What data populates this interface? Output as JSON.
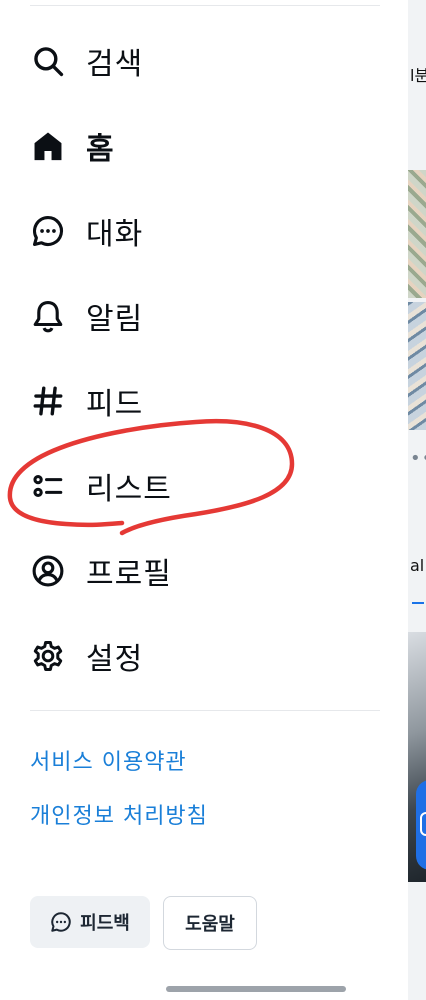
{
  "nav": {
    "items": [
      {
        "label": "검색",
        "icon": "search-icon"
      },
      {
        "label": "홈",
        "icon": "home-icon"
      },
      {
        "label": "대화",
        "icon": "chat-bubble-icon"
      },
      {
        "label": "알림",
        "icon": "bell-icon"
      },
      {
        "label": "피드",
        "icon": "hashtag-icon"
      },
      {
        "label": "리스트",
        "icon": "list-icon"
      },
      {
        "label": "프로필",
        "icon": "user-circle-icon"
      },
      {
        "label": "설정",
        "icon": "gear-icon"
      }
    ]
  },
  "links": {
    "terms": "서비스 이용약관",
    "privacy": "개인정보 처리방침"
  },
  "buttons": {
    "feedback": "피드백",
    "help": "도움말"
  },
  "background": {
    "snippet_1": "l분",
    "snippet_2": "al",
    "dots": "•••"
  },
  "colors": {
    "link": "#1a7fd8",
    "annotation": "#e53935",
    "text": "#0b0f14"
  }
}
